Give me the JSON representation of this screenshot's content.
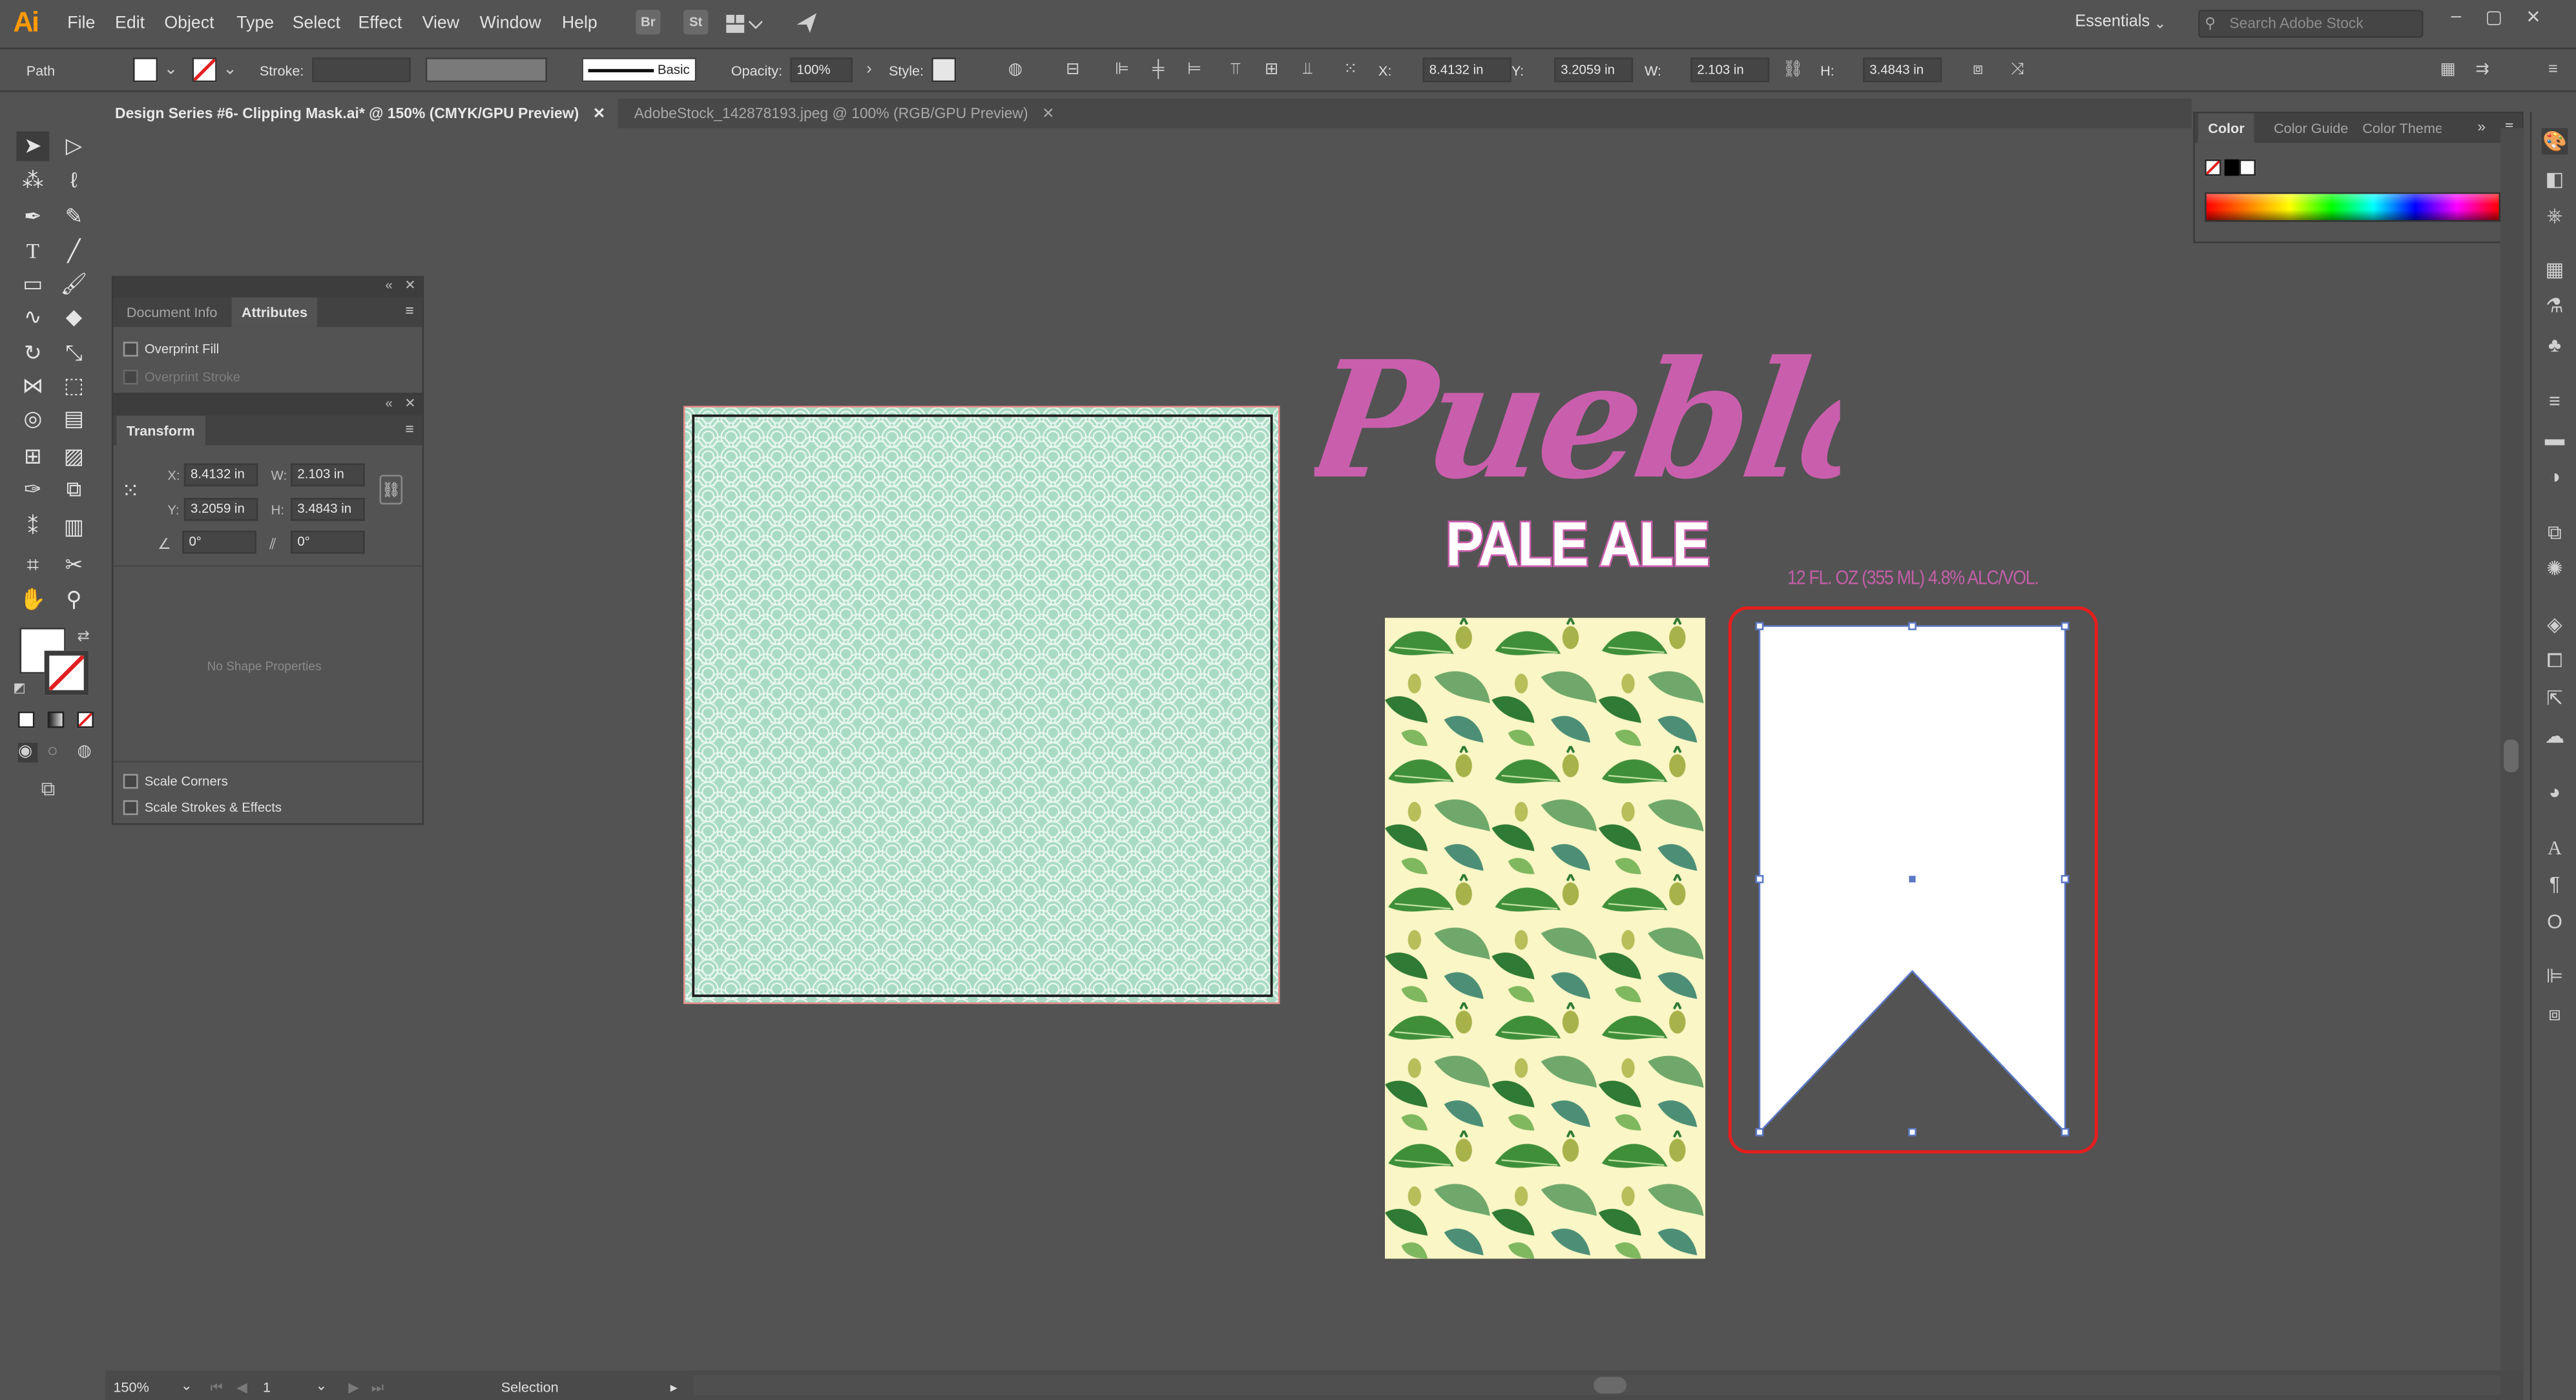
{
  "app": {
    "logo": "Ai"
  },
  "menu": {
    "items": [
      "File",
      "Edit",
      "Object",
      "Type",
      "Select",
      "Effect",
      "View",
      "Window",
      "Help"
    ],
    "br_badge": "Br",
    "st_badge": "St"
  },
  "workspace": {
    "label": "Essentials",
    "search_placeholder": "Search Adobe Stock"
  },
  "control_bar": {
    "selection_type": "Path",
    "stroke_label": "Stroke:",
    "brush_label": "Basic",
    "opacity_label": "Opacity:",
    "opacity_value": "100%",
    "style_label": "Style:",
    "x_label": "X:",
    "x_value": "8.4132 in",
    "y_label": "Y:",
    "y_value": "3.2059 in",
    "w_label": "W:",
    "w_value": "2.103 in",
    "h_label": "H:",
    "h_value": "3.4843 in"
  },
  "tabs": [
    {
      "label": "Design Series #6- Clipping Mask.ai* @ 150% (CMYK/GPU Preview)",
      "close": "✕"
    },
    {
      "label": "AdobeStock_142878193.jpeg @ 100% (RGB/GPU Preview)",
      "close": "✕"
    }
  ],
  "attributes_panel": {
    "tab_document_info": "Document Info",
    "tab_attributes": "Attributes",
    "overprint_fill": "Overprint Fill",
    "overprint_stroke": "Overprint Stroke"
  },
  "transform_panel": {
    "tab_label": "Transform",
    "x_label": "X:",
    "x_value": "8.4132 in",
    "y_label": "Y:",
    "y_value": "3.2059 in",
    "w_label": "W:",
    "w_value": "2.103 in",
    "h_label": "H:",
    "h_value": "3.4843 in",
    "angle_value": "0°",
    "shear_value": "0°",
    "no_shape": "No Shape Properties",
    "scale_corners": "Scale Corners",
    "scale_strokes": "Scale Strokes & Effects"
  },
  "color_panel": {
    "tab_color": "Color",
    "tab_guide": "Color Guide",
    "tab_themes": "Color Themes"
  },
  "artwork": {
    "title": "Puebla",
    "subtitle": "PALE ALE",
    "volume_line": "12 FL. OZ (355 ML) 4.8% ALC/VOL.",
    "title_color": "#c95fac",
    "artboard_color": "#a9dbc4",
    "highlight_color": "#e51e1e",
    "selection_color": "#5b78c4"
  },
  "status_bar": {
    "zoom": "150%",
    "artboard_num": "1",
    "tool": "Selection"
  },
  "colors": {
    "ui_bg": "#535353",
    "ai_orange": "#ff9a00"
  }
}
